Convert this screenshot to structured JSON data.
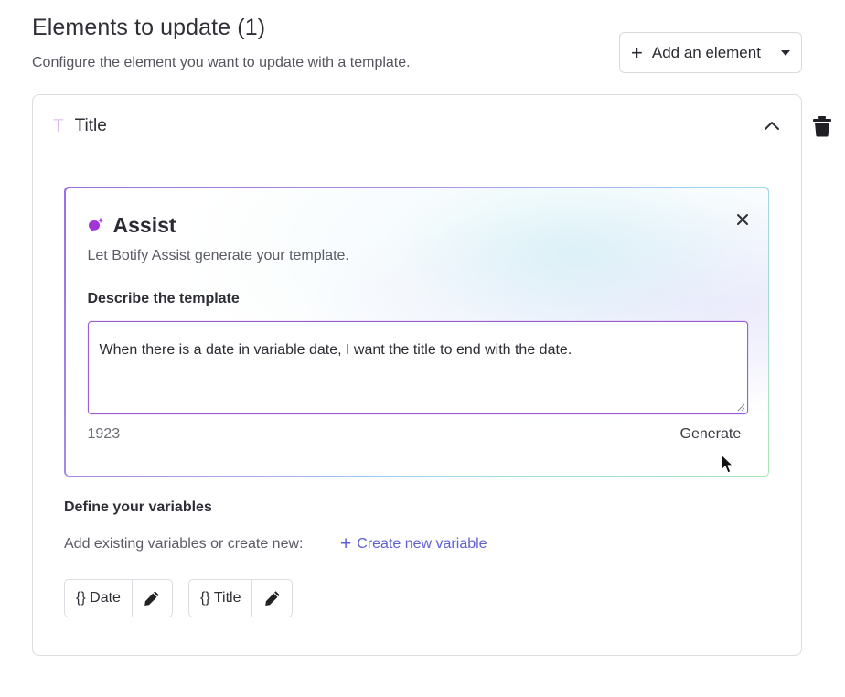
{
  "header": {
    "title": "Elements to update (1)",
    "subtitle": "Configure the element you want to update with a template.",
    "add_button_label": "Add an element"
  },
  "element_card": {
    "type_icon": "T",
    "title": "Title"
  },
  "assist": {
    "title": "Assist",
    "subtitle": "Let Botify Assist generate your template.",
    "describe_label": "Describe the template",
    "textarea_value": "When there is a date in variable date, I want the title to end with the date.",
    "char_count": "1923",
    "generate_label": "Generate"
  },
  "variables": {
    "title": "Define your variables",
    "subtitle": "Add existing variables or create new:",
    "create_label": "Create new variable",
    "items": [
      {
        "label": "{} Date"
      },
      {
        "label": "{} Title"
      }
    ]
  },
  "icons": {
    "add": "plus-icon",
    "dropdown": "caret-down-icon",
    "collapse": "chevron-up-icon",
    "delete": "trash-icon",
    "assist": "sparkle-chat-icon",
    "close": "close-icon",
    "edit": "pencil-icon"
  },
  "colors": {
    "accent_purple": "#9c5bd2",
    "link_blue": "#5e5fd3",
    "type_icon": "#c99adf"
  }
}
